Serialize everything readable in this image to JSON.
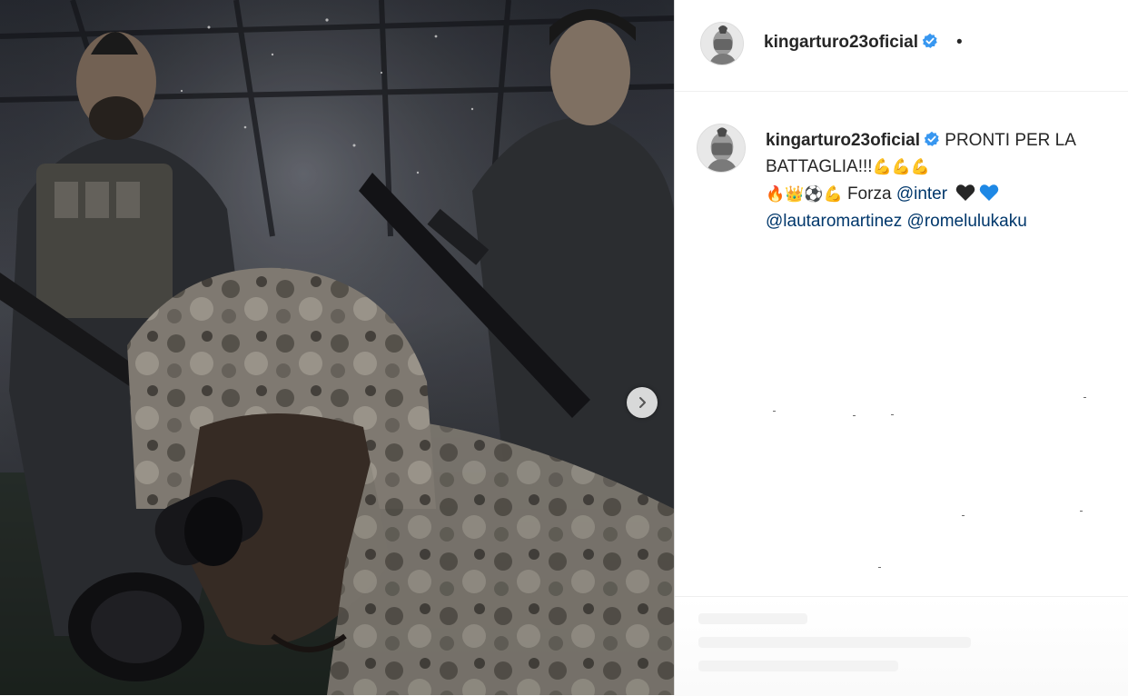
{
  "post": {
    "image_alt": "Poster of three players dressed as soldiers",
    "next_icon": "chevron-right-icon"
  },
  "header": {
    "username": "kingarturo23oficial",
    "verified_icon": "verified-badge-icon",
    "separator": "•"
  },
  "caption": {
    "username": "kingarturo23oficial",
    "text": "PRONTI PER LA BATTAGLIA!!!",
    "emojis_line1": "💪💪💪",
    "emojis_line2": "🔥👑⚽💪",
    "forza_text": "Forza",
    "mention_inter": "@inter",
    "mention_lautaro": "@lautaromartinez",
    "mention_romelu": "@romelulukaku",
    "heart_colors": [
      "#262626",
      "#1e88e5"
    ]
  }
}
